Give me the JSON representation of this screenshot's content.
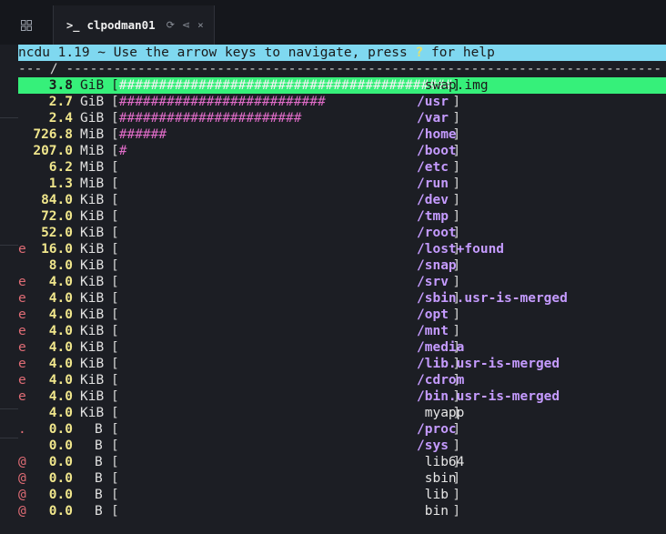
{
  "tab": {
    "title": "clpodman01",
    "prompt_glyph": ">_",
    "refresh_glyph": "⟳",
    "share_glyph": "⋖",
    "close_glyph": "×"
  },
  "terminal": {
    "header_prefix": "ncdu 1.19 ~ Use the arrow keys to navigate, press ",
    "header_key": "?",
    "header_suffix": " for help",
    "path_line": "--- / ---------------------------------------------------------------------------",
    "rows": [
      {
        "flag": "",
        "size": "3.8",
        "unit": "GiB",
        "bar": "##########################################",
        "name": " swap.img",
        "dir": false,
        "selected": true
      },
      {
        "flag": "",
        "size": "2.7",
        "unit": "GiB",
        "bar": "##########################",
        "name": "/usr",
        "dir": true
      },
      {
        "flag": "",
        "size": "2.4",
        "unit": "GiB",
        "bar": "#######################",
        "name": "/var",
        "dir": true
      },
      {
        "flag": "",
        "size": "726.8",
        "unit": "MiB",
        "bar": "######",
        "name": "/home",
        "dir": true
      },
      {
        "flag": "",
        "size": "207.0",
        "unit": "MiB",
        "bar": "#",
        "name": "/boot",
        "dir": true
      },
      {
        "flag": "",
        "size": "6.2",
        "unit": "MiB",
        "bar": "",
        "name": "/etc",
        "dir": true
      },
      {
        "flag": "",
        "size": "1.3",
        "unit": "MiB",
        "bar": "",
        "name": "/run",
        "dir": true
      },
      {
        "flag": "",
        "size": "84.0",
        "unit": "KiB",
        "bar": "",
        "name": "/dev",
        "dir": true
      },
      {
        "flag": "",
        "size": "72.0",
        "unit": "KiB",
        "bar": "",
        "name": "/tmp",
        "dir": true
      },
      {
        "flag": "",
        "size": "52.0",
        "unit": "KiB",
        "bar": "",
        "name": "/root",
        "dir": true
      },
      {
        "flag": "e",
        "size": "16.0",
        "unit": "KiB",
        "bar": "",
        "name": "/lost+found",
        "dir": true
      },
      {
        "flag": "",
        "size": "8.0",
        "unit": "KiB",
        "bar": "",
        "name": "/snap",
        "dir": true
      },
      {
        "flag": "e",
        "size": "4.0",
        "unit": "KiB",
        "bar": "",
        "name": "/srv",
        "dir": true
      },
      {
        "flag": "e",
        "size": "4.0",
        "unit": "KiB",
        "bar": "",
        "name": "/sbin.usr-is-merged",
        "dir": true
      },
      {
        "flag": "e",
        "size": "4.0",
        "unit": "KiB",
        "bar": "",
        "name": "/opt",
        "dir": true
      },
      {
        "flag": "e",
        "size": "4.0",
        "unit": "KiB",
        "bar": "",
        "name": "/mnt",
        "dir": true
      },
      {
        "flag": "e",
        "size": "4.0",
        "unit": "KiB",
        "bar": "",
        "name": "/media",
        "dir": true
      },
      {
        "flag": "e",
        "size": "4.0",
        "unit": "KiB",
        "bar": "",
        "name": "/lib.usr-is-merged",
        "dir": true
      },
      {
        "flag": "e",
        "size": "4.0",
        "unit": "KiB",
        "bar": "",
        "name": "/cdrom",
        "dir": true
      },
      {
        "flag": "e",
        "size": "4.0",
        "unit": "KiB",
        "bar": "",
        "name": "/bin.usr-is-merged",
        "dir": true
      },
      {
        "flag": "",
        "size": "4.0",
        "unit": "KiB",
        "bar": "",
        "name": " myapp",
        "dir": false
      },
      {
        "flag": ".",
        "size": "0.0",
        "unit": "B",
        "bar": "",
        "name": "/proc",
        "dir": true
      },
      {
        "flag": "",
        "size": "0.0",
        "unit": "B",
        "bar": "",
        "name": "/sys",
        "dir": true
      },
      {
        "flag": "@",
        "size": "0.0",
        "unit": "B",
        "bar": "",
        "name": " lib64",
        "dir": false
      },
      {
        "flag": "@",
        "size": "0.0",
        "unit": "B",
        "bar": "",
        "name": " sbin",
        "dir": false
      },
      {
        "flag": "@",
        "size": "0.0",
        "unit": "B",
        "bar": "",
        "name": " lib",
        "dir": false
      },
      {
        "flag": "@",
        "size": "0.0",
        "unit": "B",
        "bar": "",
        "name": " bin",
        "dir": false
      }
    ]
  }
}
